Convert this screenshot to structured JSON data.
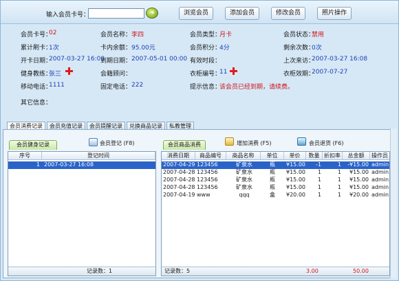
{
  "toolbar": {
    "card_label": "输入会员卡号：",
    "card_value": "",
    "browse_label": "浏览会员",
    "add_label": "添加会员",
    "edit_label": "修改会员",
    "photo_label": "照片操作"
  },
  "member": {
    "card_no_label": "会员卡号：",
    "card_no": "02",
    "name_label": "会员名称：",
    "name": "李四",
    "type_label": "会员类型：",
    "type": "月卡",
    "status_label": "会员状态：",
    "status": "禁用",
    "total_label": "累计刷卡：",
    "total": "1次",
    "balance_label": "卡内余额：",
    "balance": "95.00元",
    "points_label": "会员积分：",
    "points": "4分",
    "remaining_label": "剩余次数：",
    "remaining": "0次",
    "open_label": "开卡日期：",
    "open_date": "2007-03-27  16:08",
    "expire_label": "到期日期：",
    "expire_date": "2007-05-01  00:00",
    "valid_label": "有效时段：",
    "valid": "",
    "last_label": "上次来访：",
    "last_visit": "2007-03-27  16:08",
    "coach_label": "健身教练：",
    "coach": "张三",
    "advisor_label": "会籍顾问：",
    "advisor": "",
    "locker_label": "衣柜编号：",
    "locker": "11",
    "locker_expire_label": "衣柜效期：",
    "locker_expire": "2007-07-27",
    "mobile_label": "移动电话：",
    "mobile": "1111",
    "phone_label": "固定电话：",
    "phone": "222",
    "tip_label": "提示信息：",
    "tip": "该会员已经到期，请续费。",
    "other_label": "其它信息："
  },
  "tabs": [
    "会员消费记录",
    "会员充值记录",
    "会员提醒记录",
    "兑换商品记录",
    "私教管理"
  ],
  "left": {
    "subtab": "会员健身记录",
    "register_label": "会员登记 (F8)",
    "columns": [
      "序号",
      "登记时间"
    ],
    "rows": [
      [
        "1",
        "2007-03-27  16:08"
      ]
    ],
    "footer": "记录数：1"
  },
  "right": {
    "subtab": "会员商品消费",
    "add_label": "增加消费 (F5)",
    "return_label": "会员退货 (F6)",
    "columns": [
      "消费日期",
      "商品编号",
      "商品名称",
      "单位",
      "单价",
      "数量",
      "折扣率",
      "总金额",
      "操作员"
    ],
    "rows": [
      [
        "2007-04-29",
        "123456",
        "矿泉水",
        "瓶",
        "¥15.00",
        "-1",
        "1",
        "-¥15.00",
        "admin"
      ],
      [
        "2007-04-28",
        "123456",
        "矿泉水",
        "瓶",
        "¥15.00",
        "1",
        "1",
        "¥15.00",
        "admin"
      ],
      [
        "2007-04-28",
        "123456",
        "矿泉水",
        "瓶",
        "¥15.00",
        "1",
        "1",
        "¥15.00",
        "admin"
      ],
      [
        "2007-04-28",
        "123456",
        "矿泉水",
        "瓶",
        "¥15.00",
        "1",
        "1",
        "¥15.00",
        "admin"
      ],
      [
        "2007-04-19",
        "www",
        "qqq",
        "盒",
        "¥20.00",
        "1",
        "1",
        "¥20.00",
        "admin"
      ]
    ],
    "footer_count": "记录数：5",
    "footer_qty": "3.00",
    "footer_total": "50.00"
  },
  "colors": {
    "accent_red": "#d0141c",
    "select_blue": "#2a63c8",
    "link_blue": "#1b3fb4"
  }
}
